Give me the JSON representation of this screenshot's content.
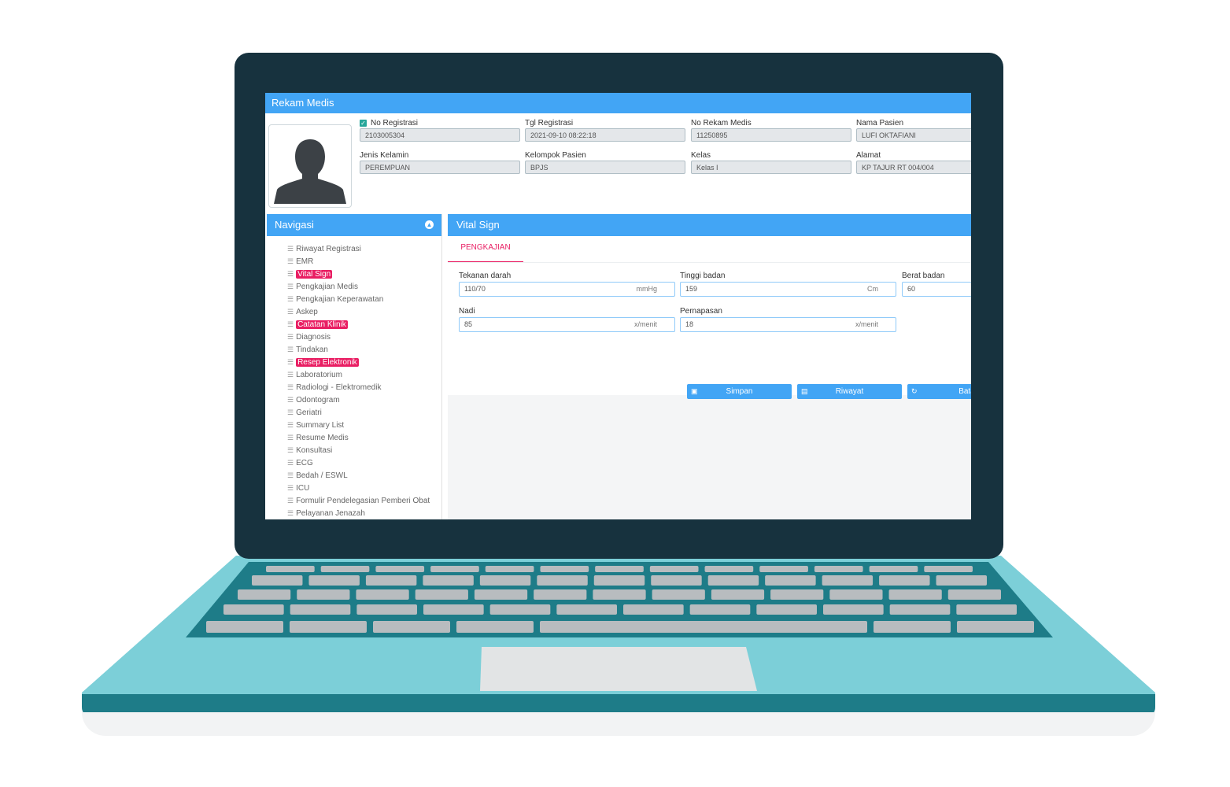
{
  "window": {
    "title": "Rekam Medis"
  },
  "patient": {
    "no_registrasi_label": "No Registrasi",
    "no_registrasi": "2103005304",
    "tgl_registrasi_label": "Tgl Registrasi",
    "tgl_registrasi": "2021-09-10 08:22:18",
    "no_rekam_medis_label": "No Rekam Medis",
    "no_rekam_medis": "11250895",
    "nama_pasien_label": "Nama Pasien",
    "nama_pasien": "LUFI OKTAFIANI",
    "jenis_kelamin_label": "Jenis Kelamin",
    "jenis_kelamin": "PEREMPUAN",
    "kelompok_pasien_label": "Kelompok Pasien",
    "kelompok_pasien": "BPJS",
    "kelas_label": "Kelas",
    "kelas": "Kelas I",
    "alamat_label": "Alamat",
    "alamat": "KP TAJUR RT 004/004"
  },
  "nav": {
    "title": "Navigasi",
    "items": [
      {
        "label": "Riwayat Registrasi",
        "highlight": false
      },
      {
        "label": "EMR",
        "highlight": false
      },
      {
        "label": "Vital Sign",
        "highlight": true
      },
      {
        "label": "Pengkajian Medis",
        "highlight": false
      },
      {
        "label": "Pengkajian Keperawatan",
        "highlight": false
      },
      {
        "label": "Askep",
        "highlight": false
      },
      {
        "label": "Catatan Klinik",
        "highlight": true
      },
      {
        "label": "Diagnosis",
        "highlight": false
      },
      {
        "label": "Tindakan",
        "highlight": false
      },
      {
        "label": "Resep Elektronik",
        "highlight": true
      },
      {
        "label": "Laboratorium",
        "highlight": false
      },
      {
        "label": "Radiologi - Elektromedik",
        "highlight": false
      },
      {
        "label": "Odontogram",
        "highlight": false
      },
      {
        "label": "Geriatri",
        "highlight": false
      },
      {
        "label": "Summary List",
        "highlight": false
      },
      {
        "label": "Resume Medis",
        "highlight": false
      },
      {
        "label": "Konsultasi",
        "highlight": false
      },
      {
        "label": "ECG",
        "highlight": false
      },
      {
        "label": "Bedah / ESWL",
        "highlight": false
      },
      {
        "label": "ICU",
        "highlight": false
      },
      {
        "label": "Formulir Pendelegasian Pemberi Obat",
        "highlight": false
      },
      {
        "label": "Pelayanan Jenazah",
        "highlight": false
      }
    ]
  },
  "vital": {
    "title": "Vital Sign",
    "tab": "PENGKAJIAN",
    "tekanan_darah_label": "Tekanan darah",
    "tekanan_darah": "110/70",
    "tekanan_darah_unit": "mmHg",
    "tinggi_badan_label": "Tinggi badan",
    "tinggi_badan": "159",
    "tinggi_badan_unit": "Cm",
    "berat_badan_label": "Berat badan",
    "berat_badan": "60",
    "nadi_label": "Nadi",
    "nadi": "85",
    "nadi_unit": "x/menit",
    "pernapasan_label": "Pernapasan",
    "pernapasan": "18",
    "pernapasan_unit": "x/menit",
    "btn_simpan": "Simpan",
    "btn_riwayat": "Riwayat",
    "btn_batal": "Batal"
  },
  "colors": {
    "accent": "#42a5f5",
    "highlight": "#e91e63",
    "bezel": "#17323e",
    "body": "#7ccfd8"
  }
}
